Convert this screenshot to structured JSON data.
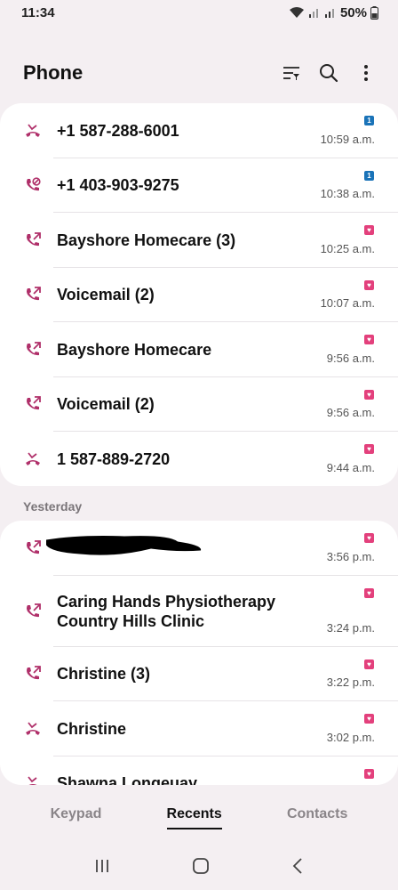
{
  "status_bar": {
    "time": "11:34",
    "battery": "50%"
  },
  "header": {
    "title": "Phone"
  },
  "today": [
    {
      "name": "+1 587-288-6001",
      "time": "10:59 a.m.",
      "type": "missed",
      "sim": "1",
      "sim_color": "#1a73b8"
    },
    {
      "name": "+1 403-903-9275",
      "time": "10:38 a.m.",
      "type": "rejected",
      "sim": "1",
      "sim_color": "#1a73b8"
    },
    {
      "name": "Bayshore Homecare (3)",
      "time": "10:25 a.m.",
      "type": "outgoing",
      "sim": "♥",
      "sim_color": "#e3407c"
    },
    {
      "name": "Voicemail (2)",
      "time": "10:07 a.m.",
      "type": "outgoing",
      "sim": "♥",
      "sim_color": "#e3407c"
    },
    {
      "name": "Bayshore Homecare",
      "time": "9:56 a.m.",
      "type": "outgoing",
      "sim": "♥",
      "sim_color": "#e3407c"
    },
    {
      "name": "Voicemail (2)",
      "time": "9:56 a.m.",
      "type": "outgoing",
      "sim": "♥",
      "sim_color": "#e3407c"
    },
    {
      "name": "1 587-889-2720",
      "time": "9:44 a.m.",
      "type": "missed",
      "sim": "♥",
      "sim_color": "#e3407c"
    }
  ],
  "yesterday_label": "Yesterday",
  "yesterday": [
    {
      "name": "",
      "time": "3:56 p.m.",
      "type": "outgoing",
      "sim": "♥",
      "sim_color": "#e3407c",
      "redacted": true
    },
    {
      "name": "Caring Hands Physiotherapy\nCountry Hills Clinic",
      "time": "3:24 p.m.",
      "type": "outgoing",
      "sim": "♥",
      "sim_color": "#e3407c"
    },
    {
      "name": "Christine (3)",
      "time": "3:22 p.m.",
      "type": "outgoing",
      "sim": "♥",
      "sim_color": "#e3407c"
    },
    {
      "name": "Christine",
      "time": "3:02 p.m.",
      "type": "missed",
      "sim": "♥",
      "sim_color": "#e3407c"
    },
    {
      "name": "Shawna Longeuay",
      "time": "",
      "type": "missed",
      "sim": "♥",
      "sim_color": "#e3407c"
    }
  ],
  "tabs": [
    {
      "label": "Keypad",
      "active": false
    },
    {
      "label": "Recents",
      "active": true
    },
    {
      "label": "Contacts",
      "active": false
    }
  ],
  "icons": {
    "accent": "#b0306a",
    "header_icons": [
      "filter-icon",
      "search-icon",
      "more-vert-icon"
    ],
    "nav_icons": [
      "recent-apps-icon",
      "home-icon",
      "back-icon"
    ]
  }
}
